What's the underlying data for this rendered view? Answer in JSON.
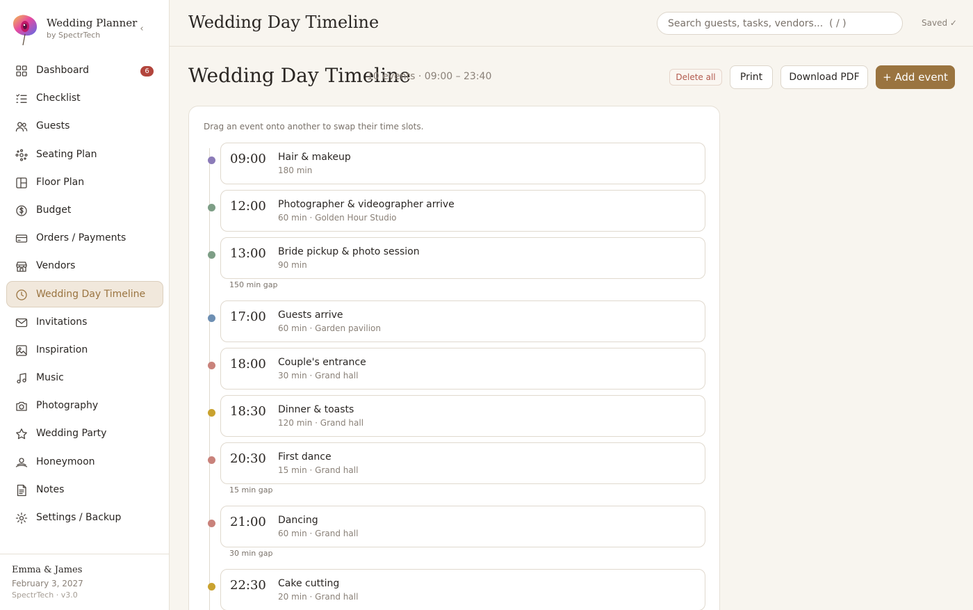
{
  "app": {
    "name": "Wedding Planner",
    "byline": "by SpectrTech"
  },
  "topbar": {
    "title": "Wedding Day Timeline",
    "search_placeholder": "Search guests, tasks, vendors...  ( / )",
    "saved": "Saved ✓"
  },
  "sidebar": {
    "items": [
      {
        "label": "Dashboard",
        "icon": "grid-icon",
        "badge": "6"
      },
      {
        "label": "Checklist",
        "icon": "checklist-icon"
      },
      {
        "label": "Guests",
        "icon": "users-icon"
      },
      {
        "label": "Seating Plan",
        "icon": "seating-icon"
      },
      {
        "label": "Floor Plan",
        "icon": "floor-plan-icon"
      },
      {
        "label": "Budget",
        "icon": "coin-icon"
      },
      {
        "label": "Orders / Payments",
        "icon": "credit-card-icon"
      },
      {
        "label": "Vendors",
        "icon": "store-icon"
      },
      {
        "label": "Wedding Day Timeline",
        "icon": "clock-icon",
        "active": true
      },
      {
        "label": "Invitations",
        "icon": "mail-icon"
      },
      {
        "label": "Inspiration",
        "icon": "image-icon"
      },
      {
        "label": "Music",
        "icon": "music-icon"
      },
      {
        "label": "Photography",
        "icon": "camera-icon"
      },
      {
        "label": "Wedding Party",
        "icon": "star-icon"
      },
      {
        "label": "Honeymoon",
        "icon": "honeymoon-icon"
      },
      {
        "label": "Notes",
        "icon": "note-icon"
      },
      {
        "label": "Settings / Backup",
        "icon": "gear-icon"
      }
    ],
    "footer": {
      "couple": "Emma & James",
      "date": "February 3, 2027",
      "version": "SpectrTech · v3.0"
    }
  },
  "page": {
    "title": "Wedding Day Timeline",
    "subtitle": "10 events · 09:00 – 23:40",
    "delete_all": "Delete all",
    "print": "Print",
    "download_pdf": "Download PDF",
    "add_event": "+ Add event",
    "hint": "Drag an event onto another to swap their time slots."
  },
  "colors": {
    "accent": "#9a7440",
    "badge": "#b2453c",
    "dot_purple": "#8b7bb8",
    "dot_green": "#7d9e86",
    "dot_blue": "#6d8fb3",
    "dot_rose": "#c9827b",
    "dot_gold": "#c9a22f"
  },
  "timeline": [
    {
      "time": "09:00",
      "title": "Hair & makeup",
      "meta": "180 min",
      "dot": "#8b7bb8"
    },
    {
      "time": "12:00",
      "title": "Photographer & videographer arrive",
      "meta": "60 min · Golden Hour Studio",
      "dot": "#7d9e86"
    },
    {
      "time": "13:00",
      "title": "Bride pickup & photo session",
      "meta": "90 min",
      "dot": "#7d9e86",
      "gap_after": "150 min gap"
    },
    {
      "time": "17:00",
      "title": "Guests arrive",
      "meta": "60 min · Garden pavilion",
      "dot": "#6d8fb3"
    },
    {
      "time": "18:00",
      "title": "Couple's entrance",
      "meta": "30 min · Grand hall",
      "dot": "#c9827b"
    },
    {
      "time": "18:30",
      "title": "Dinner & toasts",
      "meta": "120 min · Grand hall",
      "dot": "#c9a22f"
    },
    {
      "time": "20:30",
      "title": "First dance",
      "meta": "15 min · Grand hall",
      "dot": "#c9827b",
      "gap_after": "15 min gap"
    },
    {
      "time": "21:00",
      "title": "Dancing",
      "meta": "60 min · Grand hall",
      "dot": "#c9827b",
      "gap_after": "30 min gap"
    },
    {
      "time": "22:30",
      "title": "Cake cutting",
      "meta": "20 min · Grand hall",
      "dot": "#c9a22f"
    }
  ]
}
